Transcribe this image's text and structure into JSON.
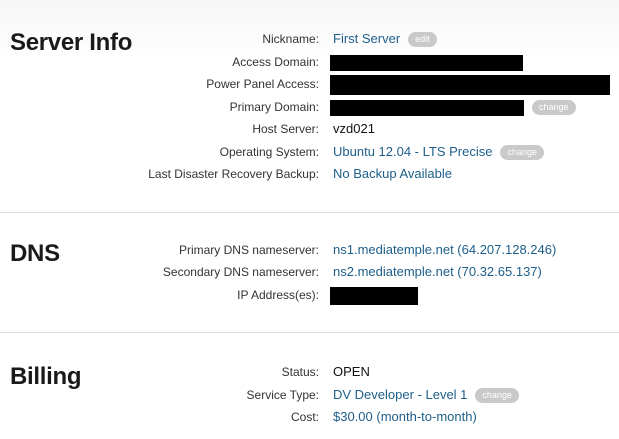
{
  "server_info": {
    "title": "Server Info",
    "nickname": {
      "label": "Nickname:",
      "value": "First Server",
      "action": "edit"
    },
    "access_domain": {
      "label": "Access Domain:"
    },
    "power_panel_access": {
      "label": "Power Panel Access:"
    },
    "primary_domain": {
      "label": "Primary Domain:",
      "action": "change"
    },
    "host_server": {
      "label": "Host Server:",
      "value": "vzd021"
    },
    "operating_system": {
      "label": "Operating System:",
      "value": "Ubuntu 12.04 - LTS Precise",
      "action": "change"
    },
    "backup": {
      "label": "Last Disaster Recovery Backup:",
      "value": "No Backup Available"
    }
  },
  "dns": {
    "title": "DNS",
    "primary_ns": {
      "label": "Primary DNS nameserver:",
      "value": "ns1.mediatemple.net (64.207.128.246)"
    },
    "secondary_ns": {
      "label": "Secondary DNS nameserver:",
      "value": "ns2.mediatemple.net (70.32.65.137)"
    },
    "ip_addresses": {
      "label": "IP Address(es):"
    }
  },
  "billing": {
    "title": "Billing",
    "status": {
      "label": "Status:",
      "value": "OPEN"
    },
    "service_type": {
      "label": "Service Type:",
      "value": "DV Developer - Level 1",
      "action": "change"
    },
    "cost": {
      "label": "Cost:",
      "value": "$30.00 (month-to-month)"
    }
  },
  "colors": {
    "link": "#1d5f8a",
    "pill": "#c9c9c9",
    "redaction": "#000000"
  }
}
